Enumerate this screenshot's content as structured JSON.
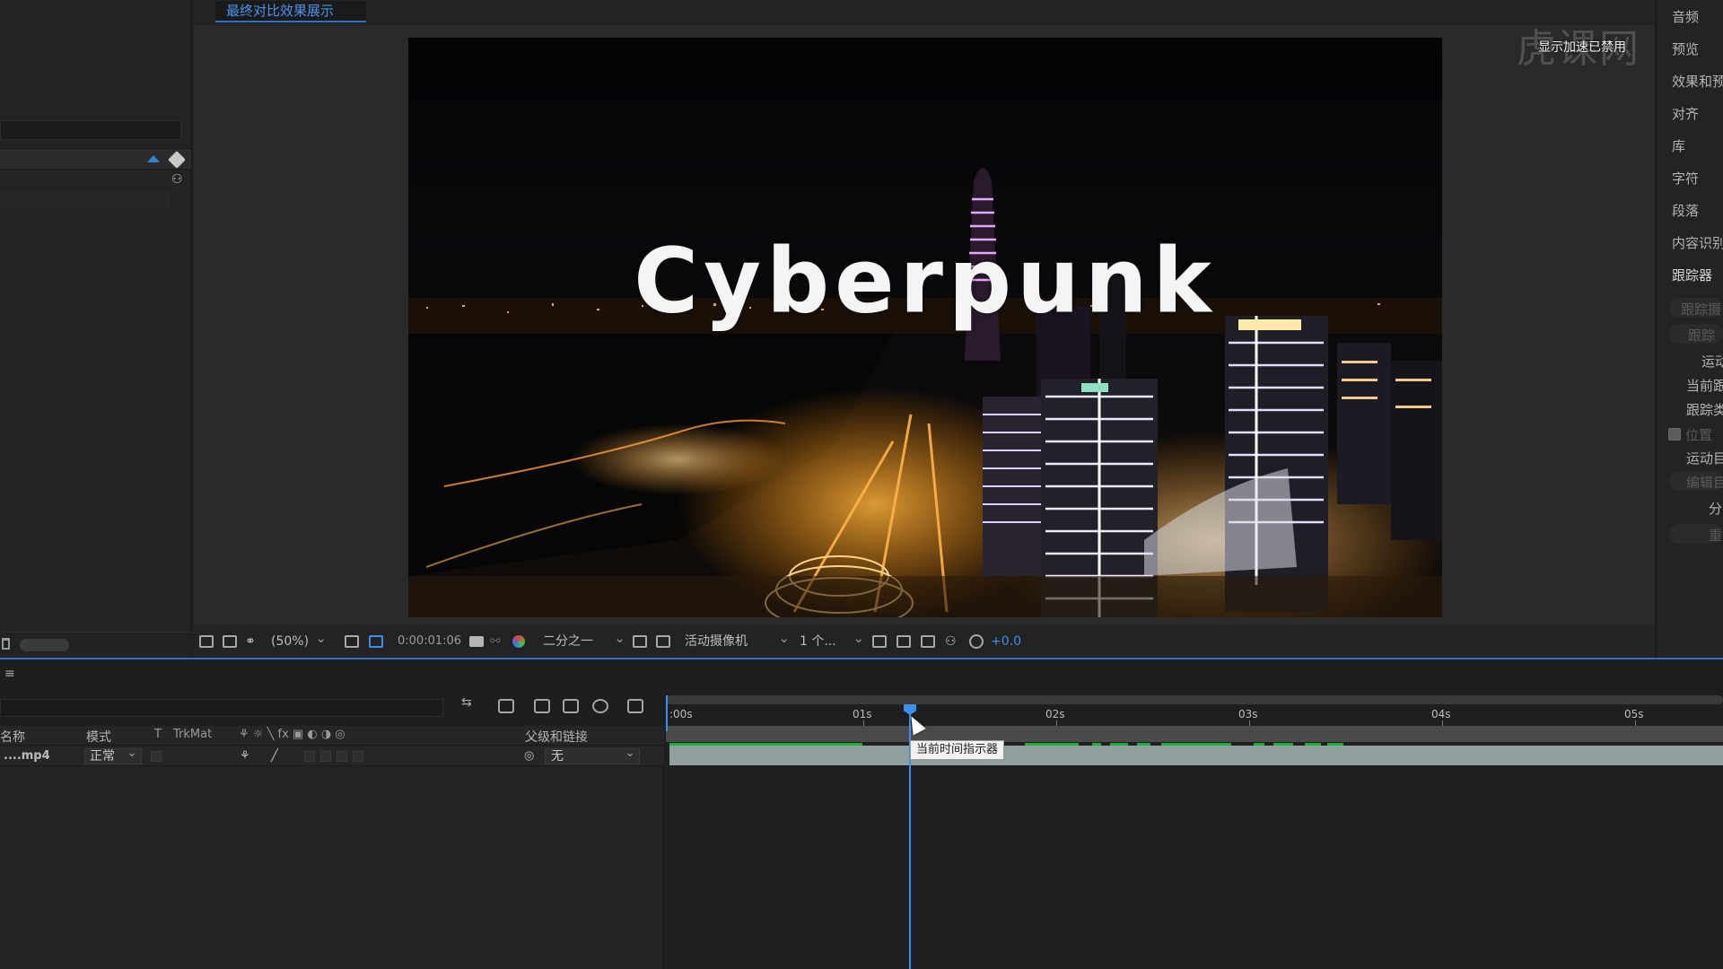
{
  "viewer": {
    "comp_tab": "最终对比效果展示",
    "comp_title_text": "Cyberpunk",
    "accel_badge": "显示加速已禁用",
    "watermark": "虎课网"
  },
  "viewer_toolbar": {
    "zoom": "(50%)",
    "timecode": "0:00:01:06",
    "resolution": "二分之一",
    "camera": "活动摄像机",
    "views": "1 个...",
    "exposure": "+0.0"
  },
  "right_panel": {
    "items": [
      "音频",
      "预览",
      "效果和预设",
      "对齐",
      "库",
      "字符",
      "段落",
      "内容识别",
      "跟踪器"
    ],
    "tracker_sub": [
      "跟踪摄",
      "跟踪",
      "运动",
      "当前跟",
      "跟踪类",
      "位置",
      "运动目",
      "编辑目",
      "分",
      "重"
    ]
  },
  "timeline": {
    "headers": {
      "name": "名称",
      "mode": "模式",
      "t": "T",
      "trkmat": "TrkMat",
      "parent": "父级和链接"
    },
    "layer": {
      "name": "....mp4",
      "mode": "正常",
      "parent": "无"
    },
    "ruler": [
      ":00s",
      "01s",
      "02s",
      "03s",
      "04s",
      "05s"
    ],
    "tooltip": "当前时间指示器"
  },
  "colors": {
    "accent_blue": "#3a8ff0",
    "layer_bar": "#8fa09e",
    "keyframe_green": "#1fae3a"
  }
}
